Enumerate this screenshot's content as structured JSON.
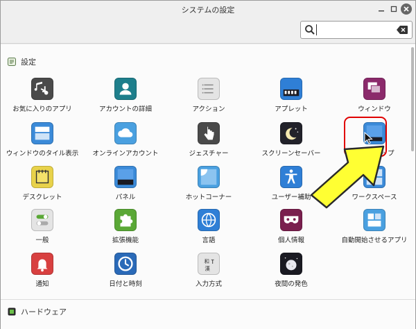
{
  "window": {
    "title": "システムの設定"
  },
  "search": {
    "value": "",
    "placeholder": ""
  },
  "sections": {
    "settings": "設定",
    "hardware": "ハードウェア"
  },
  "items": [
    {
      "label": "お気に入りのアプリ",
      "icon": "favorite-apps-icon",
      "color": "#4a4a4a"
    },
    {
      "label": "アカウントの詳細",
      "icon": "account-icon",
      "color": "#1e7f8c"
    },
    {
      "label": "アクション",
      "icon": "actions-icon",
      "color": "#e4e4e4"
    },
    {
      "label": "アプレット",
      "icon": "applets-icon",
      "color": "#2f7fd6"
    },
    {
      "label": "ウィンドウ",
      "icon": "windows-icon",
      "color": "#8b2a6b"
    },
    {
      "label": "ウィンドウのタイル表示",
      "icon": "window-tiling-icon",
      "color": "#3b8ad8"
    },
    {
      "label": "オンラインアカウント",
      "icon": "online-accounts-icon",
      "color": "#4aa0e0"
    },
    {
      "label": "ジェスチャー",
      "icon": "gestures-icon",
      "color": "#4a4a4a"
    },
    {
      "label": "スクリーンセーバー",
      "icon": "screensaver-icon",
      "color": "#22222a"
    },
    {
      "label": "デスクトップ",
      "icon": "desktop-icon",
      "color": "#3b8ad8"
    },
    {
      "label": "デスクレット",
      "icon": "desklets-icon",
      "color": "#e8d24a"
    },
    {
      "label": "パネル",
      "icon": "panel-icon",
      "color": "#3b8ad8"
    },
    {
      "label": "ホットコーナー",
      "icon": "hot-corners-icon",
      "color": "#4aa0e0"
    },
    {
      "label": "ユーザー補助",
      "icon": "accessibility-icon",
      "color": "#2f7fd6"
    },
    {
      "label": "ワークスペース",
      "icon": "workspaces-icon",
      "color": "#3b8ad8"
    },
    {
      "label": "一般",
      "icon": "general-icon",
      "color": "#e4e4e4"
    },
    {
      "label": "拡張機能",
      "icon": "extensions-icon",
      "color": "#5aa836"
    },
    {
      "label": "言語",
      "icon": "languages-icon",
      "color": "#2f7fd6"
    },
    {
      "label": "個人情報",
      "icon": "privacy-icon",
      "color": "#7a1f4e"
    },
    {
      "label": "自動開始させるアプリ",
      "icon": "startup-apps-icon",
      "color": "#4aa0e0"
    },
    {
      "label": "通知",
      "icon": "notifications-icon",
      "color": "#d84040"
    },
    {
      "label": "日付と時刻",
      "icon": "date-time-icon",
      "color": "#2a6ab8"
    },
    {
      "label": "入力方式",
      "icon": "input-method-icon",
      "color": "#e4e4e4"
    },
    {
      "label": "夜間の発色",
      "icon": "night-light-icon",
      "color": "#1a1a22"
    }
  ],
  "input_method_glyphs": {
    "top": "和",
    "bottom": "漢"
  },
  "colors": {
    "highlight": "#e00000",
    "arrow": "#ffff33"
  }
}
